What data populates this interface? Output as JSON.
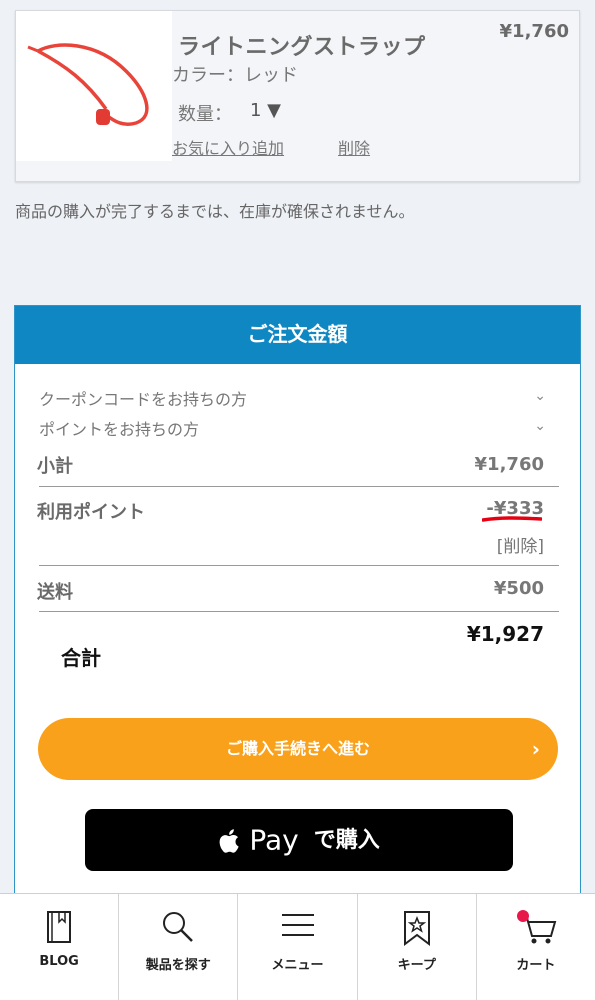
{
  "product": {
    "name": "ライトニングストラップ",
    "price": "¥1,760",
    "color": "カラー：レッド",
    "quantity_label": "数量：",
    "quantity_value": "1 ▼",
    "favorite_link": "お気に入り追加",
    "delete_link": "削除",
    "image_icon": "red-lanyard-strap-image"
  },
  "notice": "商品の購入が完了するまでは、在庫が確保されません。",
  "order": {
    "title": "ご注文金額",
    "coupon_toggle": "クーポンコードをお持ちの方",
    "points_toggle": "ポイントをお持ちの方",
    "subtotal_label": "小計",
    "subtotal_value": "¥1,760",
    "points_used_label": "利用ポイント",
    "points_used_value": "-¥333",
    "points_delete": "[削除]",
    "shipping_label": "送料",
    "shipping_value": "¥500",
    "total_label": "合計",
    "total_value": "¥1,927",
    "proceed_button": "ご購入手続きへ進む",
    "applepay_word": "Pay",
    "applepay_suffix": "で購入"
  },
  "nav": [
    {
      "label": "BLOG",
      "icon": "blog-book-icon"
    },
    {
      "label": "製品を探す",
      "icon": "search-icon"
    },
    {
      "label": "メニュー",
      "icon": "menu-icon"
    },
    {
      "label": "キープ",
      "icon": "bookmark-star-icon"
    },
    {
      "label": "カート",
      "icon": "cart-icon"
    }
  ],
  "colors": {
    "header_blue": "#0e87c2",
    "proceed_orange": "#f9a11b",
    "applepay_black": "#000000",
    "highlight_red": "#e60012",
    "cart_badge": "#e8194a"
  }
}
